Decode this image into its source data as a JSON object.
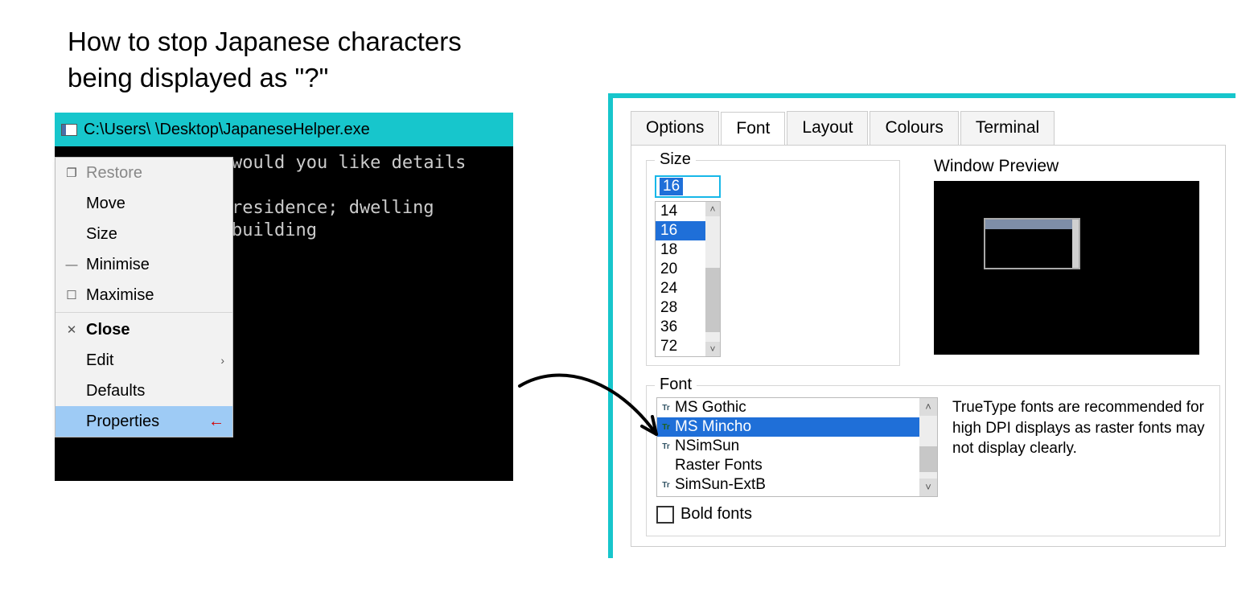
{
  "heading_line1": "How to stop Japanese characters",
  "heading_line2": "being displayed as \"?\"",
  "console": {
    "title": "C:\\Users\\           \\Desktop\\JapaneseHelper.exe",
    "line1": " would you like details ",
    "line2": "residence; dwelling",
    "line3": " building"
  },
  "menu": {
    "restore": "Restore",
    "move": "Move",
    "size": "Size",
    "minimise": "Minimise",
    "maximise": "Maximise",
    "close": "Close",
    "edit": "Edit",
    "defaults": "Defaults",
    "properties": "Properties"
  },
  "tabs": {
    "options": "Options",
    "font": "Font",
    "layout": "Layout",
    "colours": "Colours",
    "terminal": "Terminal"
  },
  "size": {
    "label": "Size",
    "current": "16",
    "options": [
      "14",
      "16",
      "18",
      "20",
      "24",
      "28",
      "36",
      "72"
    ]
  },
  "preview_label": "Window Preview",
  "font": {
    "label": "Font",
    "options": [
      "MS Gothic",
      "MS Mincho",
      "NSimSun",
      "Raster Fonts",
      "SimSun-ExtB"
    ],
    "selected_index": 1,
    "note": "TrueType fonts are recommended for high DPI displays as raster fonts may not display clearly.",
    "bold_label": "Bold fonts"
  }
}
